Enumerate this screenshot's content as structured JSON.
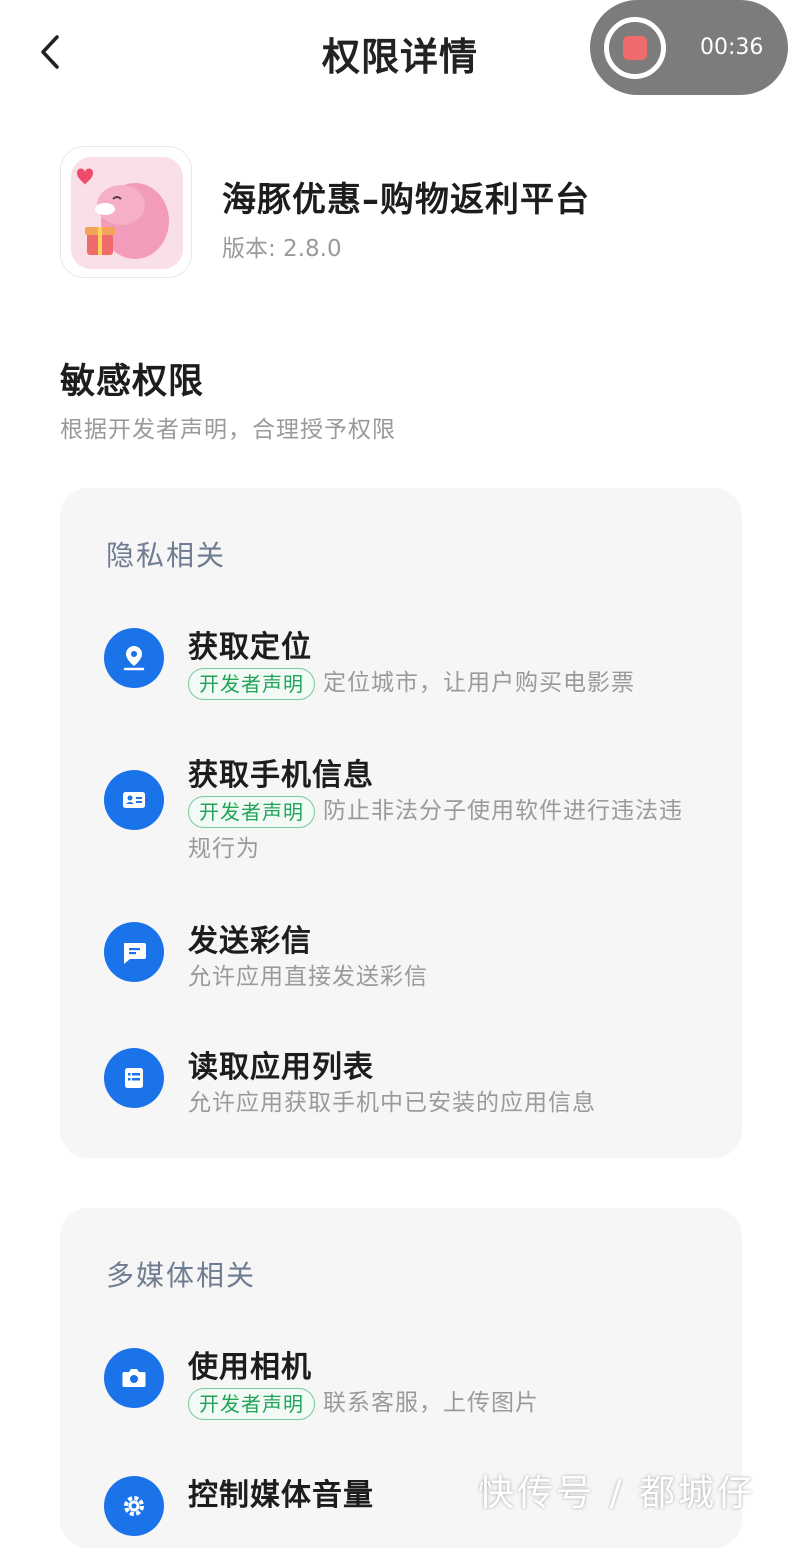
{
  "header": {
    "title": "权限详情"
  },
  "recorder": {
    "time": "00:36"
  },
  "app": {
    "name": "海豚优惠–购物返利平台",
    "version": "版本: 2.8.0"
  },
  "sensitive": {
    "title": "敏感权限",
    "subtitle": "根据开发者声明，合理授予权限"
  },
  "privacy": {
    "title": "隐私相关",
    "items": [
      {
        "title": "获取定位",
        "badge": "开发者声明",
        "desc": "定位城市，让用户购买电影票",
        "icon": "location-icon"
      },
      {
        "title": "获取手机信息",
        "badge": "开发者声明",
        "desc": "防止非法分子使用软件进行违法违规行为",
        "icon": "id-card-icon"
      },
      {
        "title": "发送彩信",
        "badge": "",
        "desc": "允许应用直接发送彩信",
        "icon": "message-icon"
      },
      {
        "title": "读取应用列表",
        "badge": "",
        "desc": "允许应用获取手机中已安装的应用信息",
        "icon": "app-list-icon"
      }
    ]
  },
  "media": {
    "title": "多媒体相关",
    "items": [
      {
        "title": "使用相机",
        "badge": "开发者声明",
        "desc": "联系客服，上传图片",
        "icon": "camera-icon"
      },
      {
        "title": "控制媒体音量",
        "badge": "",
        "desc": "",
        "icon": "gear-icon"
      }
    ]
  },
  "watermark": "快传号 / 都城仔",
  "colors": {
    "accent": "#1a73e8",
    "badge_green": "#22a35a",
    "card_bg": "#f6f6f6",
    "recorder": "#ef6a6a"
  }
}
